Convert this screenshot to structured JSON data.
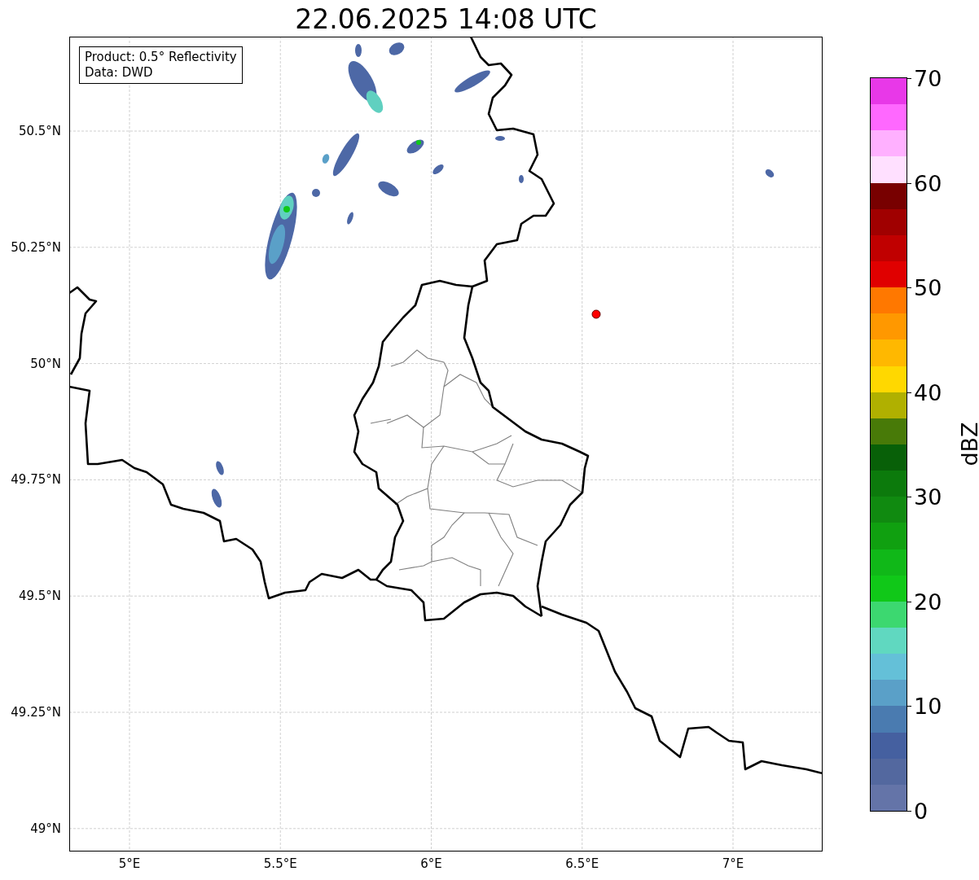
{
  "title": "22.06.2025 14:08 UTC",
  "legend": [
    "Product: 0.5° Reflectivity",
    "Data: DWD"
  ],
  "lon_ticks": [
    "5°E",
    "5.5°E",
    "6°E",
    "6.5°E",
    "7°E"
  ],
  "lat_ticks": [
    "50.5°N",
    "50.25°N",
    "50°N",
    "49.75°N",
    "49.5°N",
    "49.25°N",
    "49°N"
  ],
  "colorbar": {
    "label": "dBZ",
    "ticks": [
      "70",
      "60",
      "50",
      "40",
      "30",
      "20",
      "10",
      "0"
    ],
    "bins": [
      {
        "color": "#e838e8"
      },
      {
        "color": "#ff68ff"
      },
      {
        "color": "#ffb0ff"
      },
      {
        "color": "#ffe0ff"
      },
      {
        "color": "#780000"
      },
      {
        "color": "#a00000"
      },
      {
        "color": "#c00000"
      },
      {
        "color": "#e00000"
      },
      {
        "color": "#ff7800"
      },
      {
        "color": "#ff9800"
      },
      {
        "color": "#ffb800"
      },
      {
        "color": "#ffd800"
      },
      {
        "color": "#b0b000"
      },
      {
        "color": "#487a08"
      },
      {
        "color": "#086008"
      },
      {
        "color": "#0c7a0c"
      },
      {
        "color": "#108a10"
      },
      {
        "color": "#10a010"
      },
      {
        "color": "#10b818"
      },
      {
        "color": "#10c818"
      },
      {
        "color": "#3cd870"
      },
      {
        "color": "#60d8c0"
      },
      {
        "color": "#64c0d8"
      },
      {
        "color": "#5aa0c8"
      },
      {
        "color": "#4a7bb0"
      },
      {
        "color": "#4560a0"
      },
      {
        "color": "#53689f"
      },
      {
        "color": "#6474a8"
      }
    ]
  }
}
